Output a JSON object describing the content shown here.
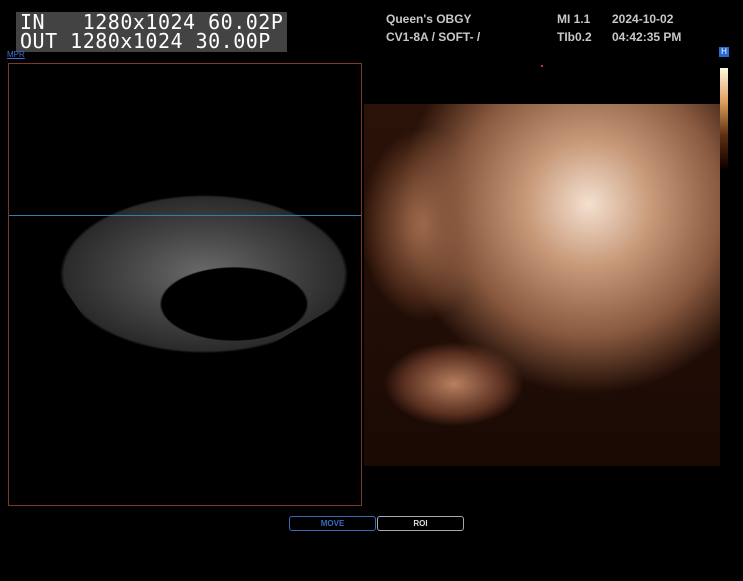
{
  "video_overlay": {
    "in_line": "IN   1280x1024 60.02P",
    "out_line": "OUT 1280x1024 30.00P"
  },
  "header": {
    "institution": "Queen's OBGY",
    "probe_preset": "CV1-8A / SOFT- /",
    "mi": "MI 1.1",
    "tib": "TIb0.2",
    "date": "2024-10-02",
    "time": "04:42:35 PM"
  },
  "mpr_label": "MPR",
  "colorbar_badge": "H",
  "buttons": {
    "move": "MOVE",
    "roi": "ROI"
  },
  "colors": {
    "active_button": "#3a6ab8",
    "panel_border": "#7a3a28"
  }
}
